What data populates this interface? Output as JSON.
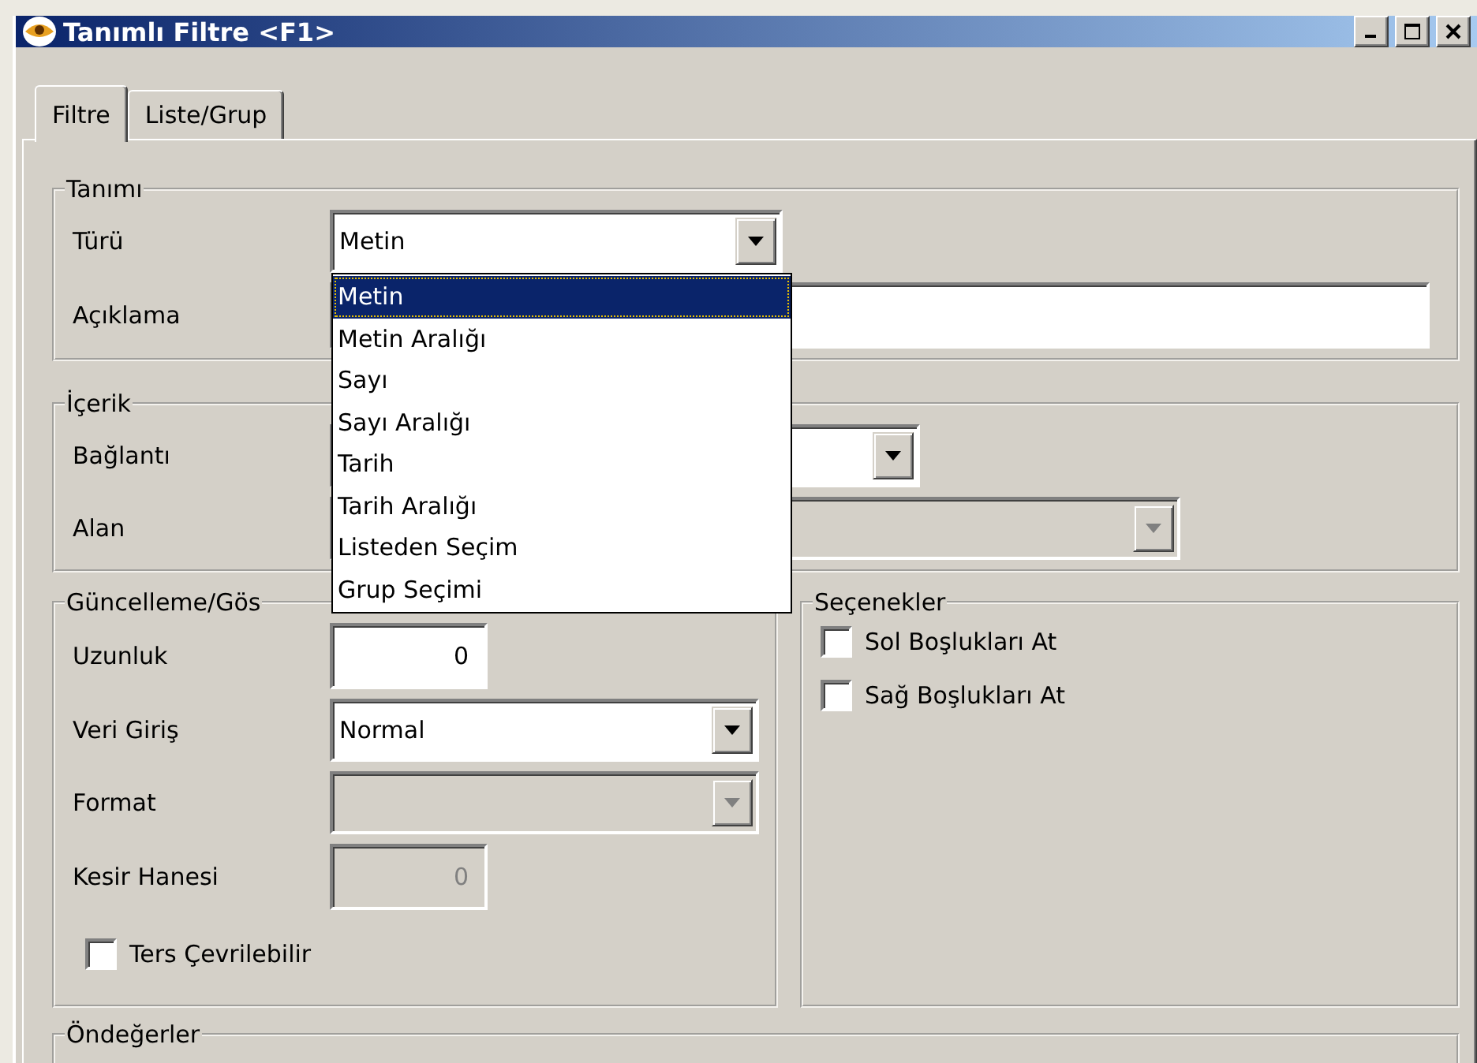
{
  "window": {
    "title": "Tanımlı Filtre <F1>"
  },
  "tabs": [
    {
      "label": "Filtre",
      "selected": true
    },
    {
      "label": "Liste/Grup",
      "selected": false
    }
  ],
  "tanimi": {
    "legend": "Tanımı",
    "fields": [
      {
        "label": "Türü",
        "kind": "combo",
        "value": "Metin",
        "disabled": false,
        "open": true
      },
      {
        "label": "Açıklama",
        "kind": "text",
        "disabled": false
      }
    ]
  },
  "dropdown": {
    "items": [
      {
        "label": "Metin",
        "selected": true
      },
      {
        "label": "Metin Aralığı",
        "selected": false
      },
      {
        "label": "Sayı",
        "selected": false
      },
      {
        "label": "Sayı Aralığı",
        "selected": false
      },
      {
        "label": "Tarih",
        "selected": false
      },
      {
        "label": "Tarih Aralığı",
        "selected": false
      },
      {
        "label": "Listeden Seçim",
        "selected": false
      },
      {
        "label": "Grup Seçimi",
        "selected": false
      }
    ]
  },
  "icerik": {
    "legend": "İçerik",
    "fields": [
      {
        "label": "Bağlantı",
        "kind": "combo",
        "disabled": false
      },
      {
        "label": "Alan",
        "kind": "combo",
        "disabled": true
      }
    ]
  },
  "guncelleme": {
    "legend": "Güncelleme/Gös",
    "fields": [
      {
        "label": "Uzunluk",
        "kind": "number",
        "value": "0",
        "disabled": false
      },
      {
        "label": "Veri Giriş",
        "kind": "combo",
        "value": "Normal",
        "disabled": false
      },
      {
        "label": "Format",
        "kind": "combo",
        "disabled": true
      },
      {
        "label": "Kesir Hanesi",
        "kind": "number",
        "value": "0",
        "disabled": true
      }
    ],
    "checkbox": {
      "label": "Ters Çevrilebilir",
      "checked": false
    }
  },
  "secenekler": {
    "legend": "Seçenekler",
    "options": [
      {
        "label": "Sol Boşlukları At",
        "checked": false
      },
      {
        "label": "Sağ Boşlukları At",
        "checked": false
      }
    ]
  },
  "ondegerler": {
    "legend": "Öndeğerler"
  }
}
